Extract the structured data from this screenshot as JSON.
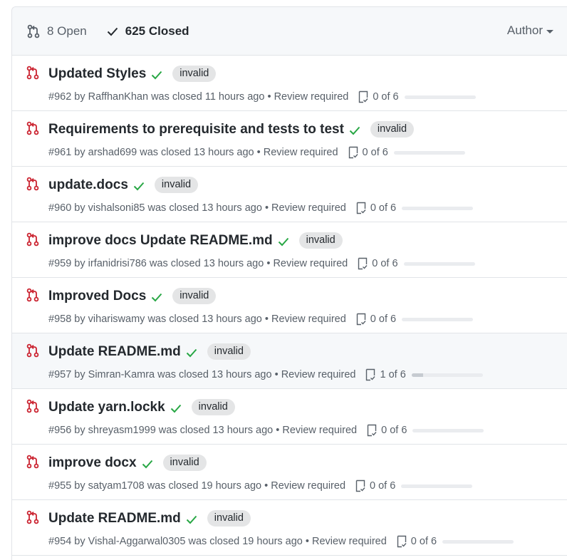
{
  "header": {
    "open_label": "8 Open",
    "closed_label": "625 Closed",
    "author_label": "Author"
  },
  "colors": {
    "closed_pr_red": "#cb2431",
    "check_green": "#28a745",
    "label_bg": "#e4e5e6"
  },
  "prs": [
    {
      "title": "Updated Styles",
      "label": "invalid",
      "number": "#962",
      "by": "by",
      "author": "RaffhanKhan",
      "closed": "was closed 11 hours ago",
      "sep": "•",
      "review": "Review required",
      "tasks": "0 of 6",
      "progress": 0
    },
    {
      "title": "Requirements to prerequisite and tests to test",
      "label": "invalid",
      "number": "#961",
      "by": "by",
      "author": "arshad699",
      "closed": "was closed 13 hours ago",
      "sep": "•",
      "review": "Review required",
      "tasks": "0 of 6",
      "progress": 0
    },
    {
      "title": "update.docs",
      "label": "invalid",
      "number": "#960",
      "by": "by",
      "author": "vishalsoni85",
      "closed": "was closed 13 hours ago",
      "sep": "•",
      "review": "Review required",
      "tasks": "0 of 6",
      "progress": 0
    },
    {
      "title": "improve docs Update README.md",
      "label": "invalid",
      "number": "#959",
      "by": "by",
      "author": "irfanidrisi786",
      "closed": "was closed 13 hours ago",
      "sep": "•",
      "review": "Review required",
      "tasks": "0 of 6",
      "progress": 0
    },
    {
      "title": "Improved Docs",
      "label": "invalid",
      "number": "#958",
      "by": "by",
      "author": "vihariswamy",
      "closed": "was closed 13 hours ago",
      "sep": "•",
      "review": "Review required",
      "tasks": "0 of 6",
      "progress": 0
    },
    {
      "title": "Update README.md",
      "label": "invalid",
      "number": "#957",
      "by": "by",
      "author": "Simran-Kamra",
      "closed": "was closed 13 hours ago",
      "sep": "•",
      "review": "Review required",
      "tasks": "1 of 6",
      "progress": 0.167
    },
    {
      "title": "Update yarn.lockk",
      "label": "invalid",
      "number": "#956",
      "by": "by",
      "author": "shreyasm1999",
      "closed": "was closed 13 hours ago",
      "sep": "•",
      "review": "Review required",
      "tasks": "0 of 6",
      "progress": 0
    },
    {
      "title": "improve docx",
      "label": "invalid",
      "number": "#955",
      "by": "by",
      "author": "satyam1708",
      "closed": "was closed 19 hours ago",
      "sep": "•",
      "review": "Review required",
      "tasks": "0 of 6",
      "progress": 0
    },
    {
      "title": "Update README.md",
      "label": "invalid",
      "number": "#954",
      "by": "by",
      "author": "Vishal-Aggarwal0305",
      "closed": "was closed 19 hours ago",
      "sep": "•",
      "review": "Review required",
      "tasks": "0 of 6",
      "progress": 0
    }
  ]
}
